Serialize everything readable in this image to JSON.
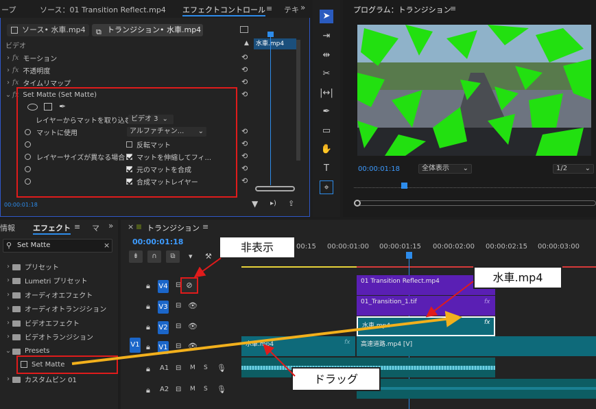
{
  "top_tabs": {
    "left_cut": "ープ",
    "source": "ソース：01 Transition Reflect.mp4",
    "effect_controls": "エフェクトコントロール",
    "menu": "≡",
    "more": "テキ",
    "program": "プログラム：トランジション",
    "program_menu": "≡"
  },
  "ec_subtabs": {
    "source": "ソース• 水車.mp4",
    "seq": "トランジション• 水車.mp4"
  },
  "ec": {
    "section": "ビデオ",
    "clip_label": "水車.mp4",
    "rows": [
      {
        "label": "モーション"
      },
      {
        "label": "不透明度"
      },
      {
        "label": "タイムリマップ"
      }
    ],
    "setmatte": {
      "title": "Set Matte (Set Matte)",
      "layer_label": "レイヤーからマットを取り込む",
      "layer_value": "ビデオ 3",
      "use_label": "マットに使用",
      "use_value": "アルファチャン...",
      "invert": "反転マット",
      "size_label": "レイヤーサイズが異なる場合",
      "stretch": "マットを伸縮してフィ...",
      "composite": "元のマットを合成",
      "premult": "合成マットレイヤー"
    },
    "timecode": "00:00:01:18"
  },
  "tools": [
    "select",
    "track-select",
    "ripple",
    "razor",
    "slip",
    "pen",
    "rectangle",
    "hand",
    "type",
    "remix"
  ],
  "program": {
    "timecode": "00:00:01:18",
    "fit": "全体表示",
    "quality": "1/2"
  },
  "project": {
    "tab_left": "情報",
    "tab": "エフェクト",
    "menu": "≡",
    "tab_right": "マ",
    "search": "Set Matte",
    "items": [
      "プリセット",
      "Lumetri プリセット",
      "オーディオエフェクト",
      "オーディオトランジション",
      "ビデオエフェクト",
      "ビデオトランジション",
      "Presets",
      "Set Matte",
      "カスタムビン 01"
    ]
  },
  "timeline": {
    "title": "トランジション",
    "menu": "≡",
    "timecode": "00:00:01:18",
    "ruler": [
      "00:15",
      "00:00:01:00",
      "00:00:01:15",
      "00:00:02:00",
      "00:00:02:15",
      "00:00:03:00"
    ],
    "tracks": [
      "V4",
      "V3",
      "V2",
      "V1",
      "A1",
      "A2"
    ],
    "src": "V1",
    "audio_tools": [
      "M",
      "S"
    ],
    "clips": {
      "v4": "01 Transition Reflect.mp4",
      "v3": "01_Transition_1.tif",
      "v2": "水車.mp4",
      "v1a": "水車.mp4",
      "v1b": "高速道路.mp4 [V]"
    }
  },
  "callouts": {
    "hide": "非表示",
    "clip": "水車.mp4",
    "drag": "ドラッグ"
  },
  "colors": {
    "accent": "#2d8ceb",
    "red": "#e01b1b",
    "green": "#22e010",
    "clip_purple": "#5a1fb4",
    "clip_teal": "#0e6a7a",
    "arrow": "#f2b01c"
  }
}
